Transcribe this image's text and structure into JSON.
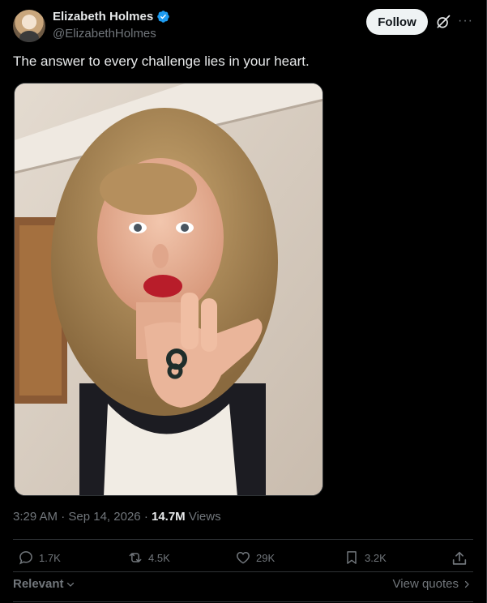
{
  "author": {
    "display_name": "Elizabeth Holmes",
    "handle": "@ElizabethHolmes",
    "verified": true
  },
  "header": {
    "follow_label": "Follow",
    "grok_icon": "grok-icon",
    "more_icon": "more-icon"
  },
  "post": {
    "text": "The answer to every challenge lies in your heart."
  },
  "meta": {
    "time": "3:29 AM",
    "date": "Sep 14, 2026",
    "views_count": "14.7M",
    "views_label": "Views"
  },
  "actions": {
    "replies": "1.7K",
    "reposts": "4.5K",
    "likes": "29K",
    "bookmarks": "3.2K"
  },
  "footer": {
    "relevant_label": "Relevant",
    "view_quotes_label": "View quotes"
  },
  "colors": {
    "background": "#000000",
    "text_primary": "#e7e9ea",
    "text_secondary": "#71767b",
    "verified_blue": "#1d9bf0",
    "divider": "#2f3336"
  }
}
